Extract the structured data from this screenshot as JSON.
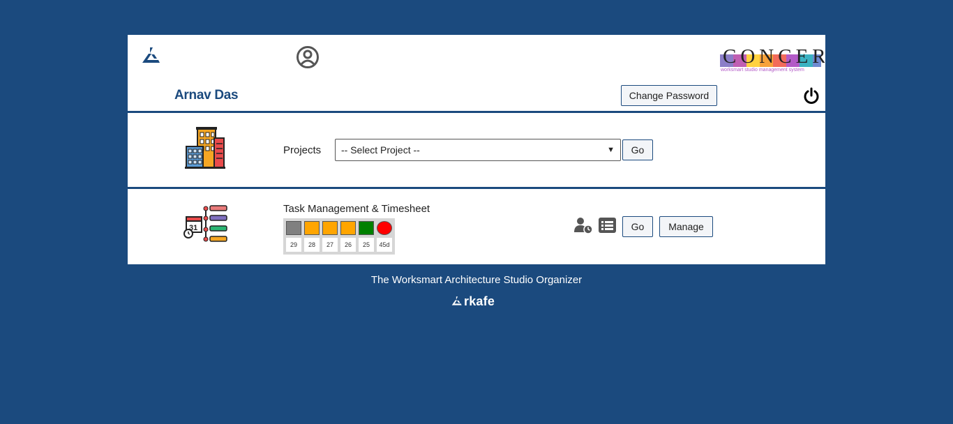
{
  "header": {
    "user_name": "Arnav Das",
    "change_password_label": "Change Password",
    "logo_text": "CONCERT",
    "logo_tagline": "worksmart studio management system",
    "icons": [
      "arkafe-mark-icon",
      "profile-icon",
      "power-icon"
    ]
  },
  "projects": {
    "label": "Projects",
    "select_value": "-- Select Project --",
    "go_label": "Go",
    "icon": "buildings-icon"
  },
  "tasks": {
    "title": "Task Management & Timesheet",
    "status": [
      {
        "label": "29",
        "color": "#808080",
        "shape": "square"
      },
      {
        "label": "28",
        "color": "#ffa500",
        "shape": "square"
      },
      {
        "label": "27",
        "color": "#ffa500",
        "shape": "square"
      },
      {
        "label": "26",
        "color": "#ffa500",
        "shape": "square"
      },
      {
        "label": "25",
        "color": "#008000",
        "shape": "square"
      },
      {
        "label": "45d",
        "color": "#ff0000",
        "shape": "circle"
      }
    ],
    "go_label": "Go",
    "manage_label": "Manage",
    "icons": [
      "calendar-timeline-icon",
      "user-clock-icon",
      "list-icon"
    ]
  },
  "footer": {
    "tagline": "The Worksmart Architecture Studio Organizer",
    "brand": "rkafe"
  },
  "colors": {
    "background": "#1b4a7e",
    "accent": "#1b4a7e"
  }
}
